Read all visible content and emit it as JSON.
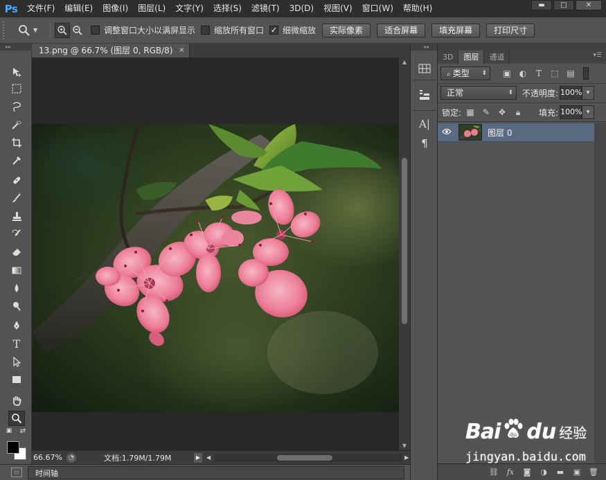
{
  "app": {
    "logo": "Ps"
  },
  "menu": [
    "文件(F)",
    "编辑(E)",
    "图像(I)",
    "图层(L)",
    "文字(Y)",
    "选择(S)",
    "滤镜(T)",
    "3D(D)",
    "视图(V)",
    "窗口(W)",
    "帮助(H)"
  ],
  "window_controls": {
    "minimize": "▬",
    "maximize": "□",
    "close": "✕"
  },
  "options": {
    "checkboxes": [
      {
        "label": "调整窗口大小以满屏显示",
        "checked": false
      },
      {
        "label": "缩放所有窗口",
        "checked": false
      },
      {
        "label": "细微缩放",
        "checked": true
      }
    ],
    "buttons": [
      "实际像素",
      "适合屏幕",
      "填充屏幕",
      "打印尺寸"
    ]
  },
  "document": {
    "tab_title": "13.png @ 66.7% (图层 0, RGB/8)",
    "close_glyph": "×",
    "zoom": "66.67%",
    "doc_info": "文档:1.79M/1.79M"
  },
  "timeline": {
    "label": "时间轴"
  },
  "layers_panel": {
    "tabs": [
      "3D",
      "图层",
      "通道"
    ],
    "active_tab": "图层",
    "filter_kind": "类型",
    "blend_mode": "正常",
    "opacity_label": "不透明度:",
    "opacity_value": "100%",
    "lock_label": "锁定:",
    "fill_label": "填充:",
    "fill_value": "100%",
    "layers": [
      {
        "name": "图层 0",
        "visible": true
      }
    ],
    "footer_icons": [
      "link-icon",
      "fx-icon",
      "mask-icon",
      "adjustment-icon",
      "group-icon",
      "new-layer-icon",
      "trash-icon"
    ]
  },
  "watermark": {
    "brand_left": "Bai",
    "brand_right": "du",
    "brand_cn": "经验",
    "url": "jingyan.baidu.com"
  },
  "colors": {
    "accent": "#4fa3ff",
    "selected_layer": "#5a6a80",
    "menubar": "#2e2e2e",
    "panel": "#535353",
    "canvas_bg": "#282828"
  }
}
